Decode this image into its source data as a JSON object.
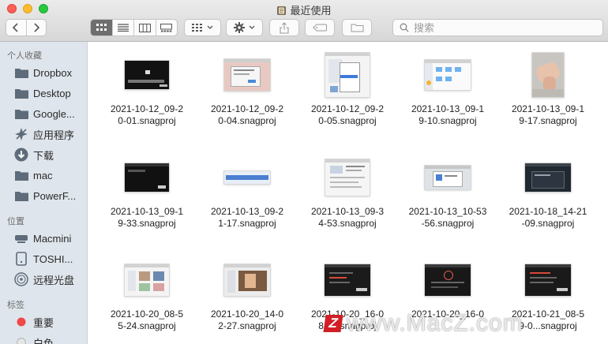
{
  "window": {
    "title": "最近使用"
  },
  "toolbar": {
    "back_icon": "chevron-left-icon",
    "forward_icon": "chevron-right-icon",
    "view_modes": [
      "icon-view",
      "list-view",
      "column-view",
      "gallery-view"
    ],
    "active_view": "icon-view",
    "group_icon": "grid-group-icon",
    "action_icon": "gear-icon",
    "share_icon": "share-icon",
    "tag_icon": "tag-icon",
    "new_folder_icon": "folder-icon",
    "search_placeholder": "搜索"
  },
  "sidebar": {
    "favorites_heading": "个人收藏",
    "favorites": [
      {
        "label": "Dropbox",
        "icon": "folder-icon"
      },
      {
        "label": "Desktop",
        "icon": "folder-icon"
      },
      {
        "label": "Google...",
        "icon": "folder-icon"
      },
      {
        "label": "应用程序",
        "icon": "applications-icon"
      },
      {
        "label": "下载",
        "icon": "download-icon"
      },
      {
        "label": "mac",
        "icon": "folder-icon"
      },
      {
        "label": "PowerF...",
        "icon": "folder-icon"
      }
    ],
    "locations_heading": "位置",
    "locations": [
      {
        "label": "Macmini",
        "icon": "computer-icon"
      },
      {
        "label": "TOSHI...",
        "icon": "drive-icon"
      },
      {
        "label": "远程光盘",
        "icon": "disc-icon"
      }
    ],
    "tags_heading": "标签",
    "tags": [
      {
        "label": "重要",
        "color": "#ef4848"
      },
      {
        "label": "白色",
        "color": "#e0e0e0"
      }
    ]
  },
  "files": [
    {
      "line1": "2021-10-12_09-2",
      "line2": "0-01.snagproj",
      "thumb": "dark"
    },
    {
      "line1": "2021-10-12_09-2",
      "line2": "0-04.snagproj",
      "thumb": "pink-dialog"
    },
    {
      "line1": "2021-10-12_09-2",
      "line2": "0-05.snagproj",
      "thumb": "menu"
    },
    {
      "line1": "2021-10-13_09-1",
      "line2": "9-10.snagproj",
      "thumb": "finder-folders"
    },
    {
      "line1": "2021-10-13_09-1",
      "line2": "9-17.snagproj",
      "thumb": "hand-photo"
    },
    {
      "line1": "2021-10-13_09-1",
      "line2": "9-33.snagproj",
      "thumb": "dark"
    },
    {
      "line1": "2021-10-13_09-2",
      "line2": "1-17.snagproj",
      "thumb": "blue-bar"
    },
    {
      "line1": "2021-10-13_09-3",
      "line2": "4-53.snagproj",
      "thumb": "settings"
    },
    {
      "line1": "2021-10-13_10-53",
      "line2": "-56.snagproj",
      "thumb": "dialog"
    },
    {
      "line1": "2021-10-18_14-21",
      "line2": "-09.snagproj",
      "thumb": "dark-desktop"
    },
    {
      "line1": "2021-10-20_08-5",
      "line2": "5-24.snagproj",
      "thumb": "photos"
    },
    {
      "line1": "2021-10-20_14-0",
      "line2": "2-27.snagproj",
      "thumb": "photo-app"
    },
    {
      "line1": "2021-10-20_16-0",
      "line2": "8-4...snagproj",
      "thumb": "dark-app"
    },
    {
      "line1": "2021-10-20_16-0",
      "line2": "",
      "thumb": "dark-app"
    },
    {
      "line1": "2021-10-21_08-5",
      "line2": "9-0...snagproj",
      "thumb": "dark-app"
    }
  ],
  "watermark": {
    "logo_text": "Z",
    "text": "www.MacZ.com"
  }
}
